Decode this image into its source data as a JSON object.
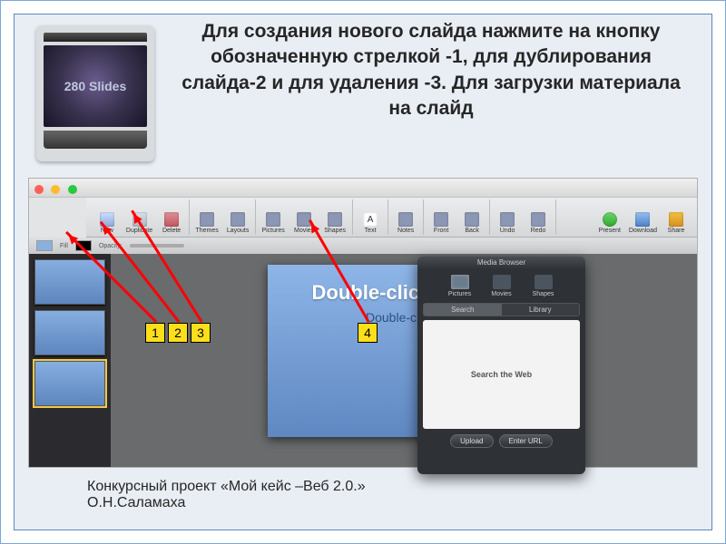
{
  "logo_text": "280 Slides",
  "headline": "Для создания нового слайда нажмите на кнопку обозначенную стрелкой -1, для дублирования слайда-2 и для удаления -3. Для загрузки материала на слайд",
  "toolbar": {
    "g1": {
      "new": "New",
      "duplicate": "Duplicate",
      "delete": "Delete"
    },
    "g2": {
      "themes": "Themes",
      "layouts": "Layouts"
    },
    "g3": {
      "pictures": "Pictures",
      "movies": "Movies",
      "shapes": "Shapes"
    },
    "g4": {
      "text": "Text"
    },
    "g5": {
      "notes": "Notes"
    },
    "g6": {
      "front": "Front",
      "back": "Back"
    },
    "g7": {
      "undo": "Undo",
      "redo": "Redo"
    },
    "g8": {
      "present": "Present",
      "download": "Download",
      "share": "Share"
    }
  },
  "optbar": {
    "fill": "Fill",
    "opacity": "Opacity:"
  },
  "slide": {
    "title": "Double-click to add",
    "subtitle": "Double-click t"
  },
  "media_browser": {
    "title": "Media Browser",
    "tabs": {
      "pictures": "Pictures",
      "movies": "Movies",
      "shapes": "Shapes"
    },
    "subtabs": {
      "search": "Search",
      "library": "Library"
    },
    "body": "Search the Web",
    "btn_upload": "Upload",
    "btn_url": "Enter URL"
  },
  "callouts": {
    "c1": "1",
    "c2": "2",
    "c3": "3",
    "c4": "4"
  },
  "footer_line1": "Конкурсный проект «Мой кейс –Веб 2.0.»",
  "footer_line2": "О.Н.Саламаха"
}
